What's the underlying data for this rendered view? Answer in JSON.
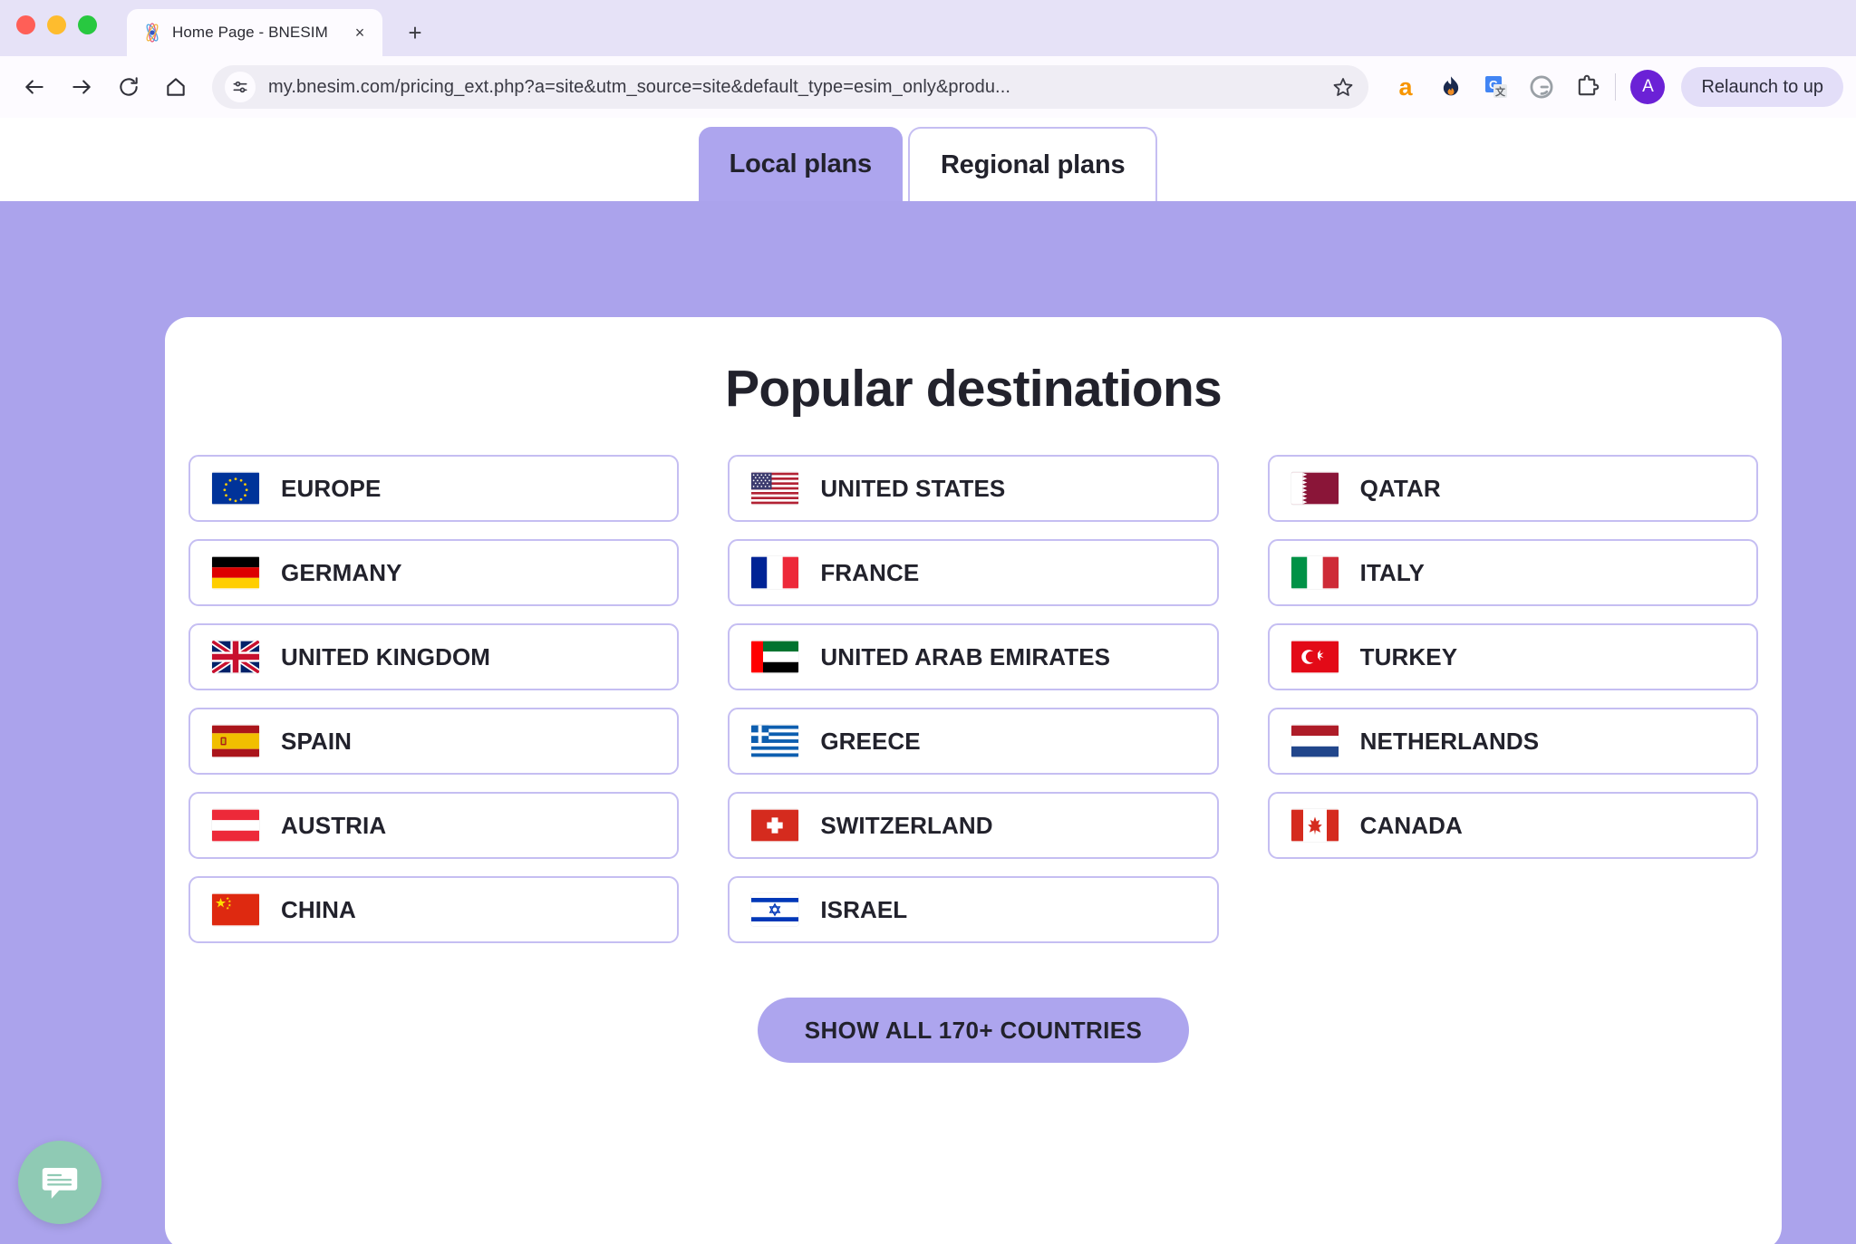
{
  "browser": {
    "tab": {
      "title": "Home Page - BNESIM",
      "favicon": "bnesim-logo-icon",
      "close": "×"
    },
    "new_tab_label": "+",
    "nav": {
      "back": "back-arrow-icon",
      "forward": "forward-arrow-icon",
      "reload": "reload-icon",
      "home": "home-icon"
    },
    "omnibox": {
      "url": "my.bnesim.com/pricing_ext.php?a=site&utm_source=site&default_type=esim_only&produ...",
      "site_settings_icon": "tune-icon",
      "bookmark_icon": "star-icon"
    },
    "extensions": [
      {
        "name": "amazon-extension-icon",
        "glyph": "a",
        "color": "#F79500"
      },
      {
        "name": "grammarly-flame-icon",
        "glyph": "",
        "color": "#1B2A4E"
      },
      {
        "name": "google-translate-icon",
        "glyph": "G",
        "color": "#4285F4"
      },
      {
        "name": "grammarly-icon",
        "glyph": "G",
        "color": "#9AA0A6"
      },
      {
        "name": "extensions-puzzle-icon",
        "glyph": "",
        "color": "#3c3c43"
      }
    ],
    "profile": {
      "initial": "A",
      "color": "#6B21D6"
    },
    "update_button": "Relaunch to up"
  },
  "page": {
    "tabs": [
      {
        "label": "Local plans",
        "active": true
      },
      {
        "label": "Regional plans",
        "active": false
      }
    ],
    "title": "Popular destinations",
    "countries": [
      {
        "name": "EUROPE",
        "flag": "europe"
      },
      {
        "name": "UNITED STATES",
        "flag": "united-states"
      },
      {
        "name": "QATAR",
        "flag": "qatar"
      },
      {
        "name": "GERMANY",
        "flag": "germany"
      },
      {
        "name": "FRANCE",
        "flag": "france"
      },
      {
        "name": "ITALY",
        "flag": "italy"
      },
      {
        "name": "UNITED KINGDOM",
        "flag": "united-kingdom"
      },
      {
        "name": "UNITED ARAB EMIRATES",
        "flag": "united-arab-emirates"
      },
      {
        "name": "TURKEY",
        "flag": "turkey"
      },
      {
        "name": "SPAIN",
        "flag": "spain"
      },
      {
        "name": "GREECE",
        "flag": "greece"
      },
      {
        "name": "NETHERLANDS",
        "flag": "netherlands"
      },
      {
        "name": "AUSTRIA",
        "flag": "austria"
      },
      {
        "name": "SWITZERLAND",
        "flag": "switzerland"
      },
      {
        "name": "CANADA",
        "flag": "canada"
      },
      {
        "name": "CHINA",
        "flag": "china"
      },
      {
        "name": "ISRAEL",
        "flag": "israel"
      }
    ],
    "show_all_button": "SHOW ALL 170+ COUNTRIES",
    "chat_widget": "chat-bubble-icon"
  },
  "colors": {
    "page_purple": "#ABA3EC",
    "tab_active_purple": "#ADA5EE",
    "card_border": "#C5BEF2",
    "button_purple": "#ADA5EE",
    "chat_green": "#8FCAB4",
    "text_dark": "#22222C"
  }
}
